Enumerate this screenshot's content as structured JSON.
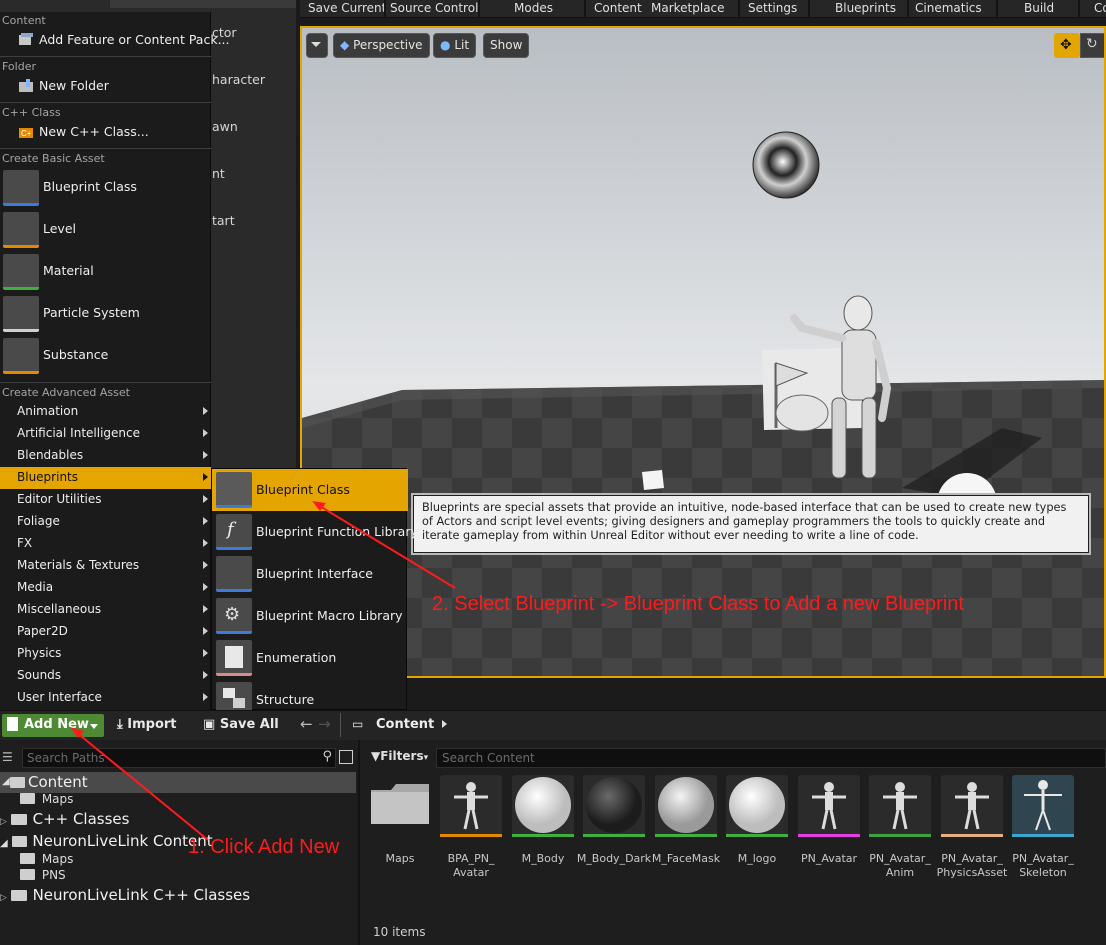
{
  "toolbar": {
    "items": [
      "Save Current",
      "Source Control",
      "Modes",
      "Content",
      "Marketplace",
      "Settings",
      "Blueprints",
      "Cinematics",
      "Build",
      "Co"
    ]
  },
  "outliner_partial": [
    "ctor",
    "haracter",
    "awn",
    "nt",
    "tart"
  ],
  "viewport": {
    "perspective": "Perspective",
    "lit": "Lit",
    "show": "Show"
  },
  "menu": {
    "section_content": "Content",
    "add_feature": "Add Feature or Content Pack...",
    "section_folder": "Folder",
    "new_folder": "New Folder",
    "section_cpp": "C++ Class",
    "new_cpp": "New C++ Class...",
    "section_basic": "Create Basic Asset",
    "basic": [
      {
        "label": "Blueprint Class",
        "color": "#3c7bd9"
      },
      {
        "label": "Level",
        "color": "#e58a00"
      },
      {
        "label": "Material",
        "color": "#3faf3f"
      },
      {
        "label": "Particle System",
        "color": "#d0d0d0"
      },
      {
        "label": "Substance",
        "color": "#e58a00"
      }
    ],
    "section_advanced": "Create Advanced Asset",
    "advanced": [
      "Animation",
      "Artificial Intelligence",
      "Blendables",
      "Blueprints",
      "Editor Utilities",
      "Foliage",
      "FX",
      "Materials & Textures",
      "Media",
      "Miscellaneous",
      "Paper2D",
      "Physics",
      "Sounds",
      "User Interface"
    ],
    "selected_advanced": "Blueprints"
  },
  "submenu": {
    "items": [
      {
        "label": "Blueprint Class",
        "color": "#3c7bd9"
      },
      {
        "label": "Blueprint Function Library",
        "color": "#3c7bd9"
      },
      {
        "label": "Blueprint Interface",
        "color": "#3c7bd9"
      },
      {
        "label": "Blueprint Macro Library",
        "color": "#3c7bd9"
      },
      {
        "label": "Enumeration",
        "color": "#d88a8a"
      },
      {
        "label": "Structure",
        "color": "#3aa6d0"
      }
    ],
    "selected": "Blueprint Class"
  },
  "tooltip": "Blueprints are special assets that provide an intuitive, node-based interface that can be used to create new types of Actors and script level events; giving designers and gameplay programmers the tools to quickly create and iterate gameplay from within Unreal Editor without ever needing to write a line of code.",
  "annotations": {
    "step1": "1. Click Add New",
    "step2": "2. Select Blueprint -> Blueprint Class to Add a new Blueprint"
  },
  "content_bar": {
    "add_new": "Add New",
    "import": "Import",
    "save_all": "Save All",
    "breadcrumb": "Content"
  },
  "paths": {
    "search_placeholder": "Search Paths",
    "tree": [
      {
        "label": "Content",
        "level": 0
      },
      {
        "label": "Maps",
        "level": 1
      },
      {
        "label": "C++ Classes",
        "level": 0
      },
      {
        "label": "NeuronLiveLink Content",
        "level": 0
      },
      {
        "label": "Maps",
        "level": 1
      },
      {
        "label": "PNS",
        "level": 1
      },
      {
        "label": "NeuronLiveLink C++ Classes",
        "level": 0
      }
    ]
  },
  "assets": {
    "filters": "Filters",
    "search_placeholder": "Search Content",
    "items": [
      {
        "label": "Maps",
        "color": ""
      },
      {
        "label": "BPA_PN_\nAvatar",
        "color": "#e58a00"
      },
      {
        "label": "M_Body",
        "color": "#3faf3f"
      },
      {
        "label": "M_Body_Dark",
        "color": "#3faf3f"
      },
      {
        "label": "M_FaceMask",
        "color": "#3faf3f"
      },
      {
        "label": "M_logo",
        "color": "#3faf3f"
      },
      {
        "label": "PN_Avatar",
        "color": "#e040e0"
      },
      {
        "label": "PN_Avatar_\nAnim",
        "color": "#3fa03f"
      },
      {
        "label": "PN_Avatar_\nPhysicsAsset",
        "color": "#e8b080"
      },
      {
        "label": "PN_Avatar_\nSkeleton",
        "color": "#3aa6d0"
      }
    ],
    "count": "10 items"
  }
}
